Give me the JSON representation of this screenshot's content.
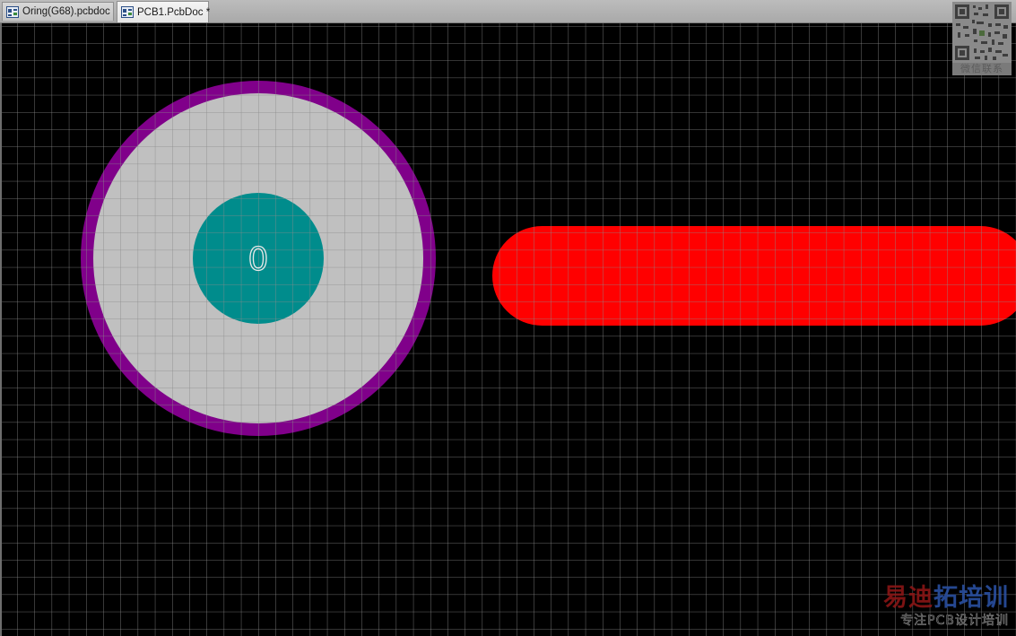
{
  "tabs": [
    {
      "label": "Oring(G68).pcbdoc",
      "active": false,
      "icon": "pcb-doc-icon"
    },
    {
      "label": "PCB1.PcbDoc *",
      "active": true,
      "icon": "pcb-doc-icon"
    }
  ],
  "canvas": {
    "background": "#000000",
    "grid_color": "#8a8a8a",
    "pad": {
      "designator": "0",
      "ring_color": "#80008a",
      "copper_color": "#c0c0c0",
      "hole_color": "#008c8c",
      "designator_color": "#e8e8e8"
    },
    "track_color": "#ff0000"
  },
  "watermark": {
    "qr_label": "微信联系",
    "line1_red": "易迪",
    "line1_blue": "拓培训",
    "line2": "专注PCB设计培训"
  }
}
